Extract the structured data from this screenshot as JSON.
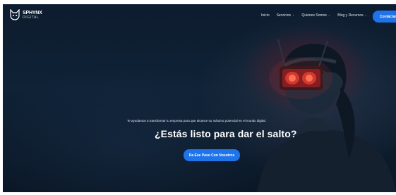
{
  "brand": {
    "name": "SPHYNX",
    "sub": "DIGITAL",
    "logo_icon": "sphynx-cat-icon"
  },
  "nav": {
    "items": [
      {
        "label": "Inicio",
        "dropdown": false
      },
      {
        "label": "Servicios",
        "dropdown": true
      },
      {
        "label": "Quienes Somos",
        "dropdown": true
      },
      {
        "label": "Blog y Recursos",
        "dropdown": true
      }
    ],
    "chevron": "⌄",
    "cta_label": "Contáctanos"
  },
  "hero": {
    "tagline": "Te ayudamos a transformar tu empresa para que alcance su máximo potencial en el mundo digital.",
    "headline": "¿Estás listo para dar el salto?",
    "cta_label": "Da Ese Paso Con Nosotros"
  },
  "colors": {
    "accent": "#1e73e8",
    "background": "#0d1c2e",
    "headset_glow": "#c0392b"
  }
}
